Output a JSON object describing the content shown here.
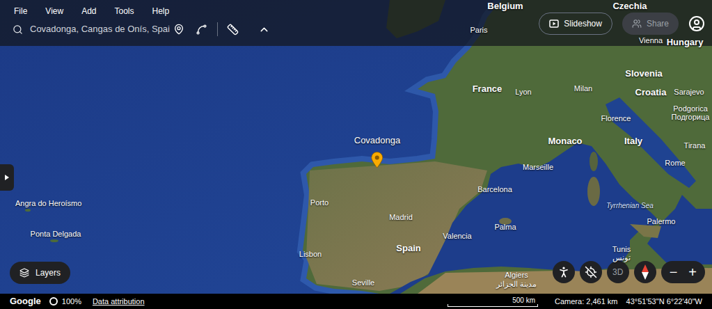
{
  "menu": [
    "File",
    "View",
    "Add",
    "Tools",
    "Help"
  ],
  "search": {
    "value": "Covadonga, Cangas de Onís, Spai"
  },
  "slideshow": {
    "label": "Slideshow"
  },
  "share": {
    "label": "Share",
    "disabled": true
  },
  "map": {
    "pin": {
      "label": "Covadonga",
      "selected": true
    },
    "labels": [
      {
        "text": "Belgium",
        "kind": "country"
      },
      {
        "text": "Czechia",
        "kind": "country"
      },
      {
        "text": "Paris",
        "kind": "city"
      },
      {
        "text": "Vienna",
        "kind": "city"
      },
      {
        "text": "Hungary",
        "kind": "country"
      },
      {
        "text": "Slovenia",
        "kind": "country"
      },
      {
        "text": "France",
        "kind": "country"
      },
      {
        "text": "Lyon",
        "kind": "city"
      },
      {
        "text": "Milan",
        "kind": "city"
      },
      {
        "text": "Croatia",
        "kind": "country"
      },
      {
        "text": "Sarajevo",
        "kind": "city"
      },
      {
        "text": "Podgorica",
        "kind": "city"
      },
      {
        "text": "Подгорица",
        "kind": "city"
      },
      {
        "text": "Florence",
        "kind": "city"
      },
      {
        "text": "Monaco",
        "kind": "country"
      },
      {
        "text": "Italy",
        "kind": "country"
      },
      {
        "text": "Tirana",
        "kind": "city"
      },
      {
        "text": "Rome",
        "kind": "city"
      },
      {
        "text": "Marseille",
        "kind": "city"
      },
      {
        "text": "Barcelona",
        "kind": "city"
      },
      {
        "text": "Porto",
        "kind": "city"
      },
      {
        "text": "Angra do Heroísmo",
        "kind": "city"
      },
      {
        "text": "Tyrrhenian Sea",
        "kind": "sea"
      },
      {
        "text": "Madrid",
        "kind": "city"
      },
      {
        "text": "Palermo",
        "kind": "city"
      },
      {
        "text": "Palma",
        "kind": "city"
      },
      {
        "text": "Ponta Delgada",
        "kind": "city"
      },
      {
        "text": "Valencia",
        "kind": "city"
      },
      {
        "text": "Spain",
        "kind": "country"
      },
      {
        "text": "Tunis",
        "kind": "city"
      },
      {
        "text": "تونس",
        "kind": "city"
      },
      {
        "text": "Lisbon",
        "kind": "city"
      },
      {
        "text": "Algiers",
        "kind": "city"
      },
      {
        "text": "مدينة الجزائر",
        "kind": "city"
      },
      {
        "text": "Seville",
        "kind": "city"
      }
    ]
  },
  "controls": {
    "layers": "Layers",
    "view_3d": "3D",
    "zoom_out": "−",
    "zoom_in": "+"
  },
  "status_bar": {
    "brand": "Google",
    "zoom": "100%",
    "attribution": "Data attribution",
    "scale": "500 km",
    "camera": "Camera: 2,461 km",
    "coords": "43°51'53\"N 6°22'40\"W"
  }
}
